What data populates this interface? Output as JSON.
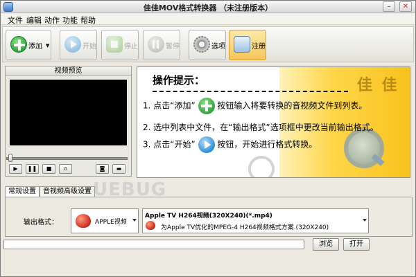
{
  "window": {
    "title": "佳佳MOV格式转换器 （未注册版本）"
  },
  "menu": [
    "文件",
    "编辑",
    "动作",
    "功能",
    "帮助"
  ],
  "toolbar": {
    "add": "添加",
    "start": "开始",
    "stop": "停止",
    "pause": "暂停",
    "options": "选项",
    "register": "注册"
  },
  "preview": {
    "header": "视频预览"
  },
  "hint": {
    "title": "操作提示：",
    "step1_a": "1. 点击“添加”",
    "step1_b": "按钮输入将要转换的音视频文件到列表。",
    "step2": "2. 选中列表中文件，在“输出格式”选项框中更改当前输出格式。",
    "step3_a": "3. 点击“开始”",
    "step3_b": "按钮，开始进行格式转换。",
    "brand": "佳 佳"
  },
  "watermark": "UEBUG",
  "tabs": [
    "常规设置",
    "音视频高级设置"
  ],
  "settings": {
    "output_label": "输出格式：",
    "category": "APPLE视频",
    "format_title": "Apple TV H264视频(320X240)(*.mp4)",
    "format_desc": "为Apple TV优化的MPEG-4 H264视频格式方案.(320X240)"
  },
  "buttons": {
    "browse": "浏览",
    "open": "打开"
  },
  "colors": {
    "hint_yellow": "#ffd64a",
    "add_green": "#2fa53a",
    "start_blue": "#2a8fd8"
  }
}
